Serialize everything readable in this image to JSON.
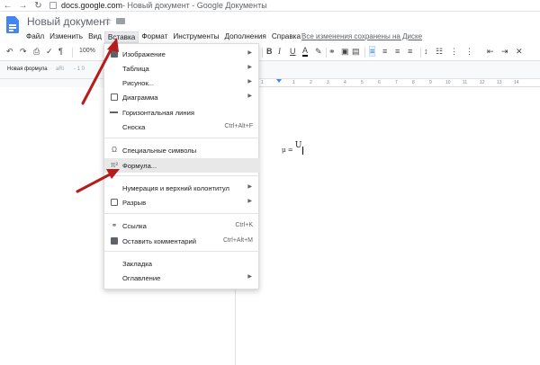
{
  "browser": {
    "back_icon": "arrow-left-icon",
    "forward_icon": "arrow-right-icon",
    "reload_icon": "reload-icon",
    "url_host": "docs.google.com",
    "url_rest": " - Новый документ - Google Документы"
  },
  "header": {
    "title": "Новый документ",
    "menu": [
      "Файл",
      "Изменить",
      "Вид",
      "Вставка",
      "Формат",
      "Инструменты",
      "Дополнения",
      "Справка"
    ],
    "active_menu": "Вставка",
    "saved_status": "Все изменения сохранены на Диске"
  },
  "toolbar": {
    "zoom": "100%",
    "bold": "B",
    "italic": "I",
    "underline": "U",
    "text_color": "A"
  },
  "style_row": {
    "style": "Новая формула",
    "font": "aRi",
    "size": "- 1 0"
  },
  "ruler": {
    "ticks": [
      "1",
      "1",
      "2",
      "3",
      "4",
      "5",
      "6",
      "7",
      "8",
      "9",
      "10",
      "11",
      "12",
      "13",
      "14"
    ]
  },
  "document": {
    "equation_left": "μ = ",
    "equation_cap": "U"
  },
  "insert_menu": {
    "items": [
      {
        "label": "Изображение",
        "icon": "image-icon",
        "submenu": true
      },
      {
        "label": "Таблица",
        "icon": "",
        "submenu": true
      },
      {
        "label": "Рисунок...",
        "icon": "",
        "submenu": true
      },
      {
        "label": "Диаграмма",
        "icon": "chart-icon",
        "submenu": true
      },
      {
        "label": "Горизонтальная линия",
        "icon": "horizontal-line-icon",
        "submenu": false
      },
      {
        "label": "Сноска",
        "icon": "",
        "shortcut": "Ctrl+Alt+F"
      },
      {
        "label": "Специальные символы",
        "icon": "omega-icon",
        "submenu": false
      },
      {
        "label": "Формула...",
        "icon": "pi-icon",
        "submenu": false
      },
      {
        "label": "Нумерация и верхний колонтитул",
        "icon": "",
        "submenu": true
      },
      {
        "label": "Разрыв",
        "icon": "page-break-icon",
        "submenu": true
      },
      {
        "label": "Ссылка",
        "icon": "link-icon",
        "shortcut": "Ctrl+K"
      },
      {
        "label": "Оставить комментарий",
        "icon": "comment-icon",
        "shortcut": "Ctrl+Alt+M"
      },
      {
        "label": "Закладка",
        "icon": "",
        "submenu": false
      },
      {
        "label": "Оглавление",
        "icon": "",
        "submenu": true
      }
    ],
    "highlighted": "Формула..."
  },
  "colors": {
    "accent": "#1a73e8",
    "logo": "#4285f4",
    "arrow": "#b71c1c"
  }
}
